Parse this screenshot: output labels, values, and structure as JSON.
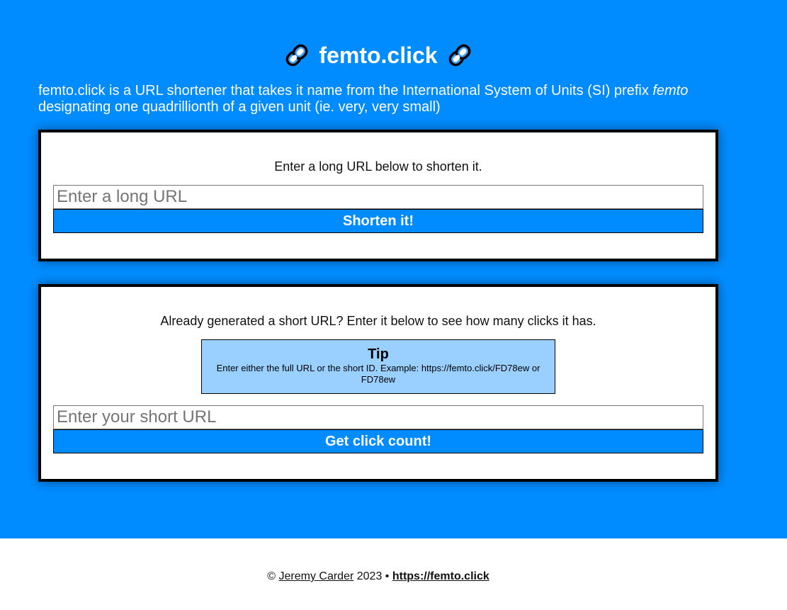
{
  "header": {
    "title": "femto.click",
    "icon_left": "link-icon",
    "icon_right": "link-icon"
  },
  "intro": {
    "text_before": "femto.click is a URL shortener that takes it name from the International System of Units (SI) prefix ",
    "emphasis": "femto",
    "text_after": " designating one quadrillionth of a given unit (ie. very, very small)"
  },
  "shorten_card": {
    "prompt": "Enter a long URL below to shorten it.",
    "input_placeholder": "Enter a long URL",
    "input_value": "",
    "button_label": "Shorten it!"
  },
  "count_card": {
    "prompt": "Already generated a short URL? Enter it below to see how many clicks it has.",
    "tip_title": "Tip",
    "tip_body": "Enter either the full URL or the short ID. Example: https://femto.click/FD78ew or FD78ew",
    "input_placeholder": "Enter your short URL",
    "input_value": "",
    "button_label": "Get click count!"
  },
  "footer": {
    "copyright_symbol": "©",
    "author": "Jeremy Carder",
    "year_sep": " 2023 • ",
    "site_link": "https://femto.click"
  },
  "colors": {
    "brand_blue": "#008cff",
    "tip_blue": "#99d0ff"
  }
}
